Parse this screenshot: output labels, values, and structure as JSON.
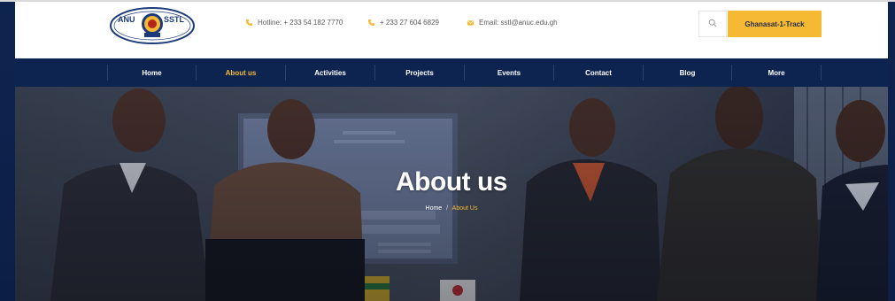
{
  "header": {
    "logo": {
      "left_text": "ANU",
      "right_text": "SSTL"
    },
    "hotline_label": "Hotline: + 233 54 182 7770",
    "phone_label": "+ 233 27 604 6829",
    "email_label": "Email: sstl@anuc.edu.gh",
    "cta_label": "Ghanasat-1-Track"
  },
  "nav": {
    "items": [
      {
        "label": "Home"
      },
      {
        "label": "About us"
      },
      {
        "label": "Activities"
      },
      {
        "label": "Projects"
      },
      {
        "label": "Events"
      },
      {
        "label": "Contact"
      },
      {
        "label": "Blog"
      },
      {
        "label": "More"
      }
    ],
    "active": "About us"
  },
  "hero": {
    "title": "About us",
    "breadcrumb": {
      "home": "Home",
      "separator": "/",
      "current": "About Us"
    }
  },
  "colors": {
    "navy": "#0e2450",
    "accent": "#f6b934",
    "white": "#ffffff"
  },
  "icons": [
    "phone-icon",
    "phone-icon",
    "email-icon",
    "search-icon"
  ]
}
